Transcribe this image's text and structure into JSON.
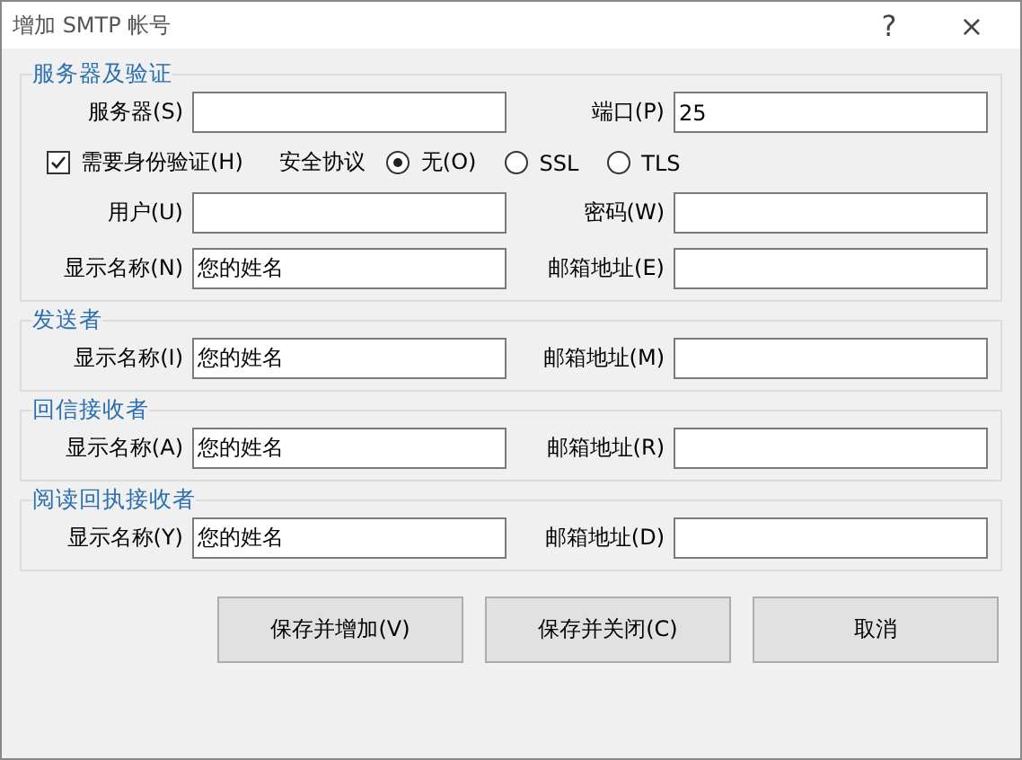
{
  "window": {
    "title": "增加 SMTP 帐号",
    "help": "?",
    "close": "×"
  },
  "groups": [
    {
      "title": "服务器及验证",
      "rows": [
        {
          "kind": "fields",
          "fields": [
            {
              "label": "服务器(S)"
            },
            {
              "label": "端口(P)",
              "value": "25"
            }
          ]
        },
        {
          "kind": "options",
          "auth": {
            "label": "需要身份验证(H)",
            "checked": true
          },
          "protocol_label": "安全协议",
          "protocols": [
            {
              "label": "无(O)",
              "selected": true
            },
            {
              "label": "SSL",
              "selected": false
            },
            {
              "label": "TLS",
              "selected": false
            }
          ]
        },
        {
          "kind": "fields",
          "fields": [
            {
              "label": "用户(U)"
            },
            {
              "label": "密码(W)"
            }
          ]
        },
        {
          "kind": "fields",
          "fields": [
            {
              "label": "显示名称(N)",
              "value": "您的姓名"
            },
            {
              "label": "邮箱地址(E)"
            }
          ]
        }
      ]
    },
    {
      "title": "发送者",
      "rows": [
        {
          "kind": "fields",
          "fields": [
            {
              "label": "显示名称(I)",
              "value": "您的姓名"
            },
            {
              "label": "邮箱地址(M)"
            }
          ]
        }
      ]
    },
    {
      "title": "回信接收者",
      "rows": [
        {
          "kind": "fields",
          "fields": [
            {
              "label": "显示名称(A)",
              "value": "您的姓名"
            },
            {
              "label": "邮箱地址(R)"
            }
          ]
        }
      ]
    },
    {
      "title": "阅读回执接收者",
      "rows": [
        {
          "kind": "fields",
          "fields": [
            {
              "label": "显示名称(Y)",
              "value": "您的姓名"
            },
            {
              "label": "邮箱地址(D)"
            }
          ]
        }
      ]
    }
  ],
  "buttons": [
    "保存并增加(V)",
    "保存并关闭(C)",
    "取消"
  ]
}
